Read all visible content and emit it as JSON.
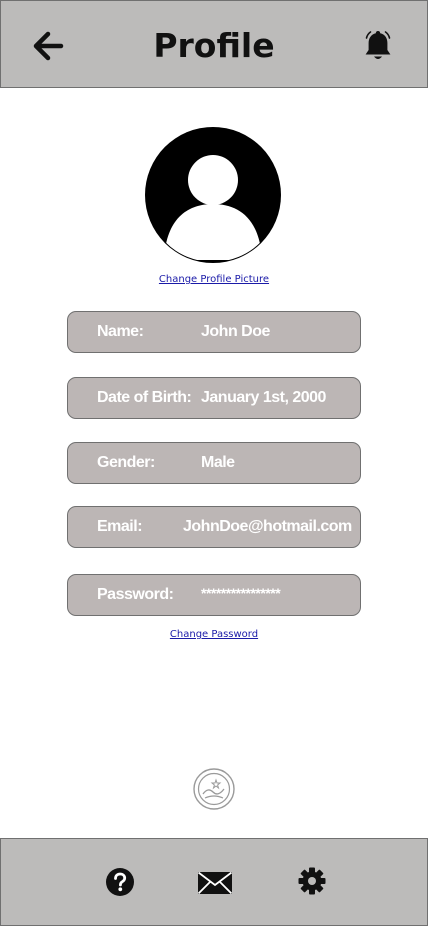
{
  "header": {
    "title": "Profile",
    "back_icon": "arrow-left-icon",
    "notification_icon": "bell-icon"
  },
  "profile": {
    "avatar_icon": "user-avatar-icon",
    "change_picture_label": "Change Profile Picture"
  },
  "fields": {
    "name": {
      "label": "Name:",
      "value": "John Doe"
    },
    "dob": {
      "label": "Date of Birth:",
      "value": "January 1st, 2000"
    },
    "gender": {
      "label": "Gender:",
      "value": "Male"
    },
    "email": {
      "label": "Email:",
      "value": "JohnDoe@hotmail.com"
    },
    "password": {
      "label": "Password:",
      "value": "****************"
    }
  },
  "change_password_label": "Change Password",
  "footer": {
    "help_icon": "question-mark-icon",
    "mail_icon": "envelope-icon",
    "settings_icon": "gear-icon"
  },
  "colors": {
    "bar_background": "#bcbbba",
    "field_background": "#bcb6b5",
    "field_text": "#ffffff",
    "link": "#1a1aa8"
  }
}
